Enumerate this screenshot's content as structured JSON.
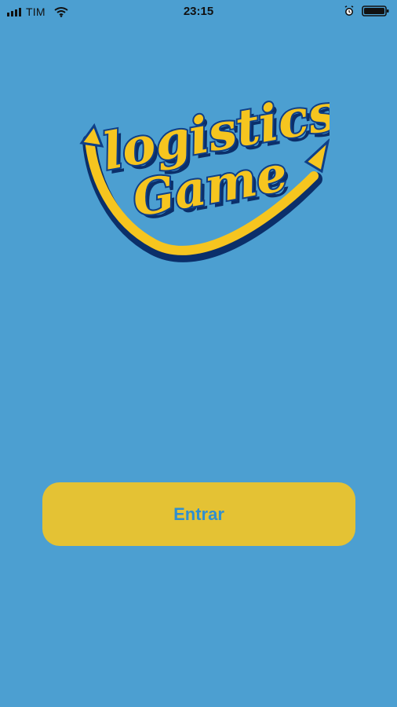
{
  "status_bar": {
    "carrier": "TIM",
    "time": "23:15",
    "icons": [
      "signal-icon",
      "wifi-icon",
      "alarm-icon",
      "battery-icon"
    ]
  },
  "logo": {
    "word_1": "logistics",
    "word_2": "Game",
    "colors": {
      "fill": "#f6c51f",
      "outline": "#0f3f88",
      "shadow": "#0b2f6a"
    }
  },
  "actions": {
    "enter_label": "Entrar"
  },
  "colors": {
    "background": "#4c9fd1",
    "button_bg": "#e4c234",
    "button_text": "#2f8fd0"
  }
}
